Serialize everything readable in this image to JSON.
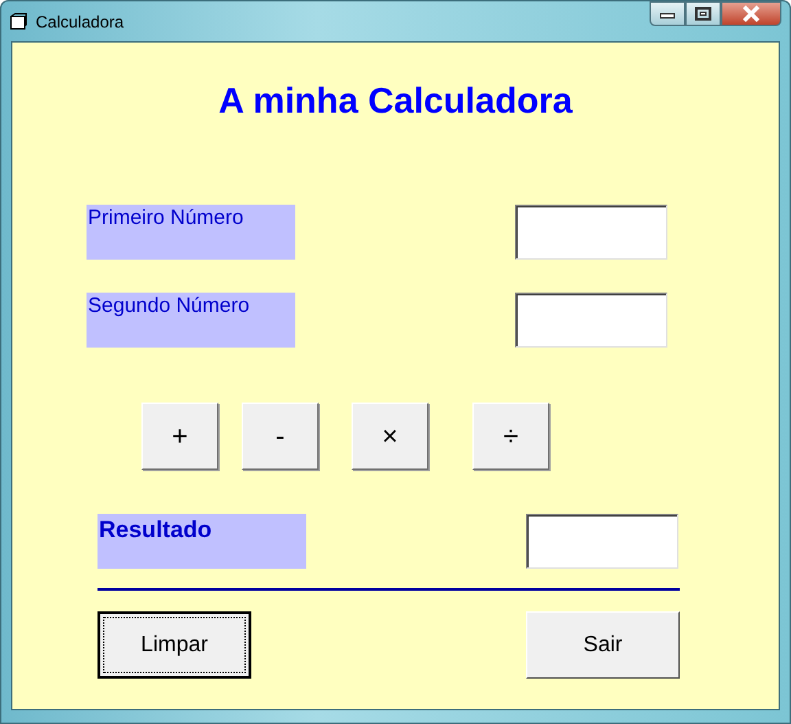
{
  "window": {
    "title": "Calculadora"
  },
  "heading": "A minha Calculadora",
  "inputs": [
    {
      "label": "Primeiro Número"
    },
    {
      "label": "Segundo Número"
    }
  ],
  "operators": [
    "+",
    "-",
    "×",
    "÷"
  ],
  "result": {
    "label": "Resultado"
  },
  "buttons": [
    {
      "label": "Limpar",
      "focused": true
    },
    {
      "label": "Sair",
      "focused": false
    }
  ]
}
